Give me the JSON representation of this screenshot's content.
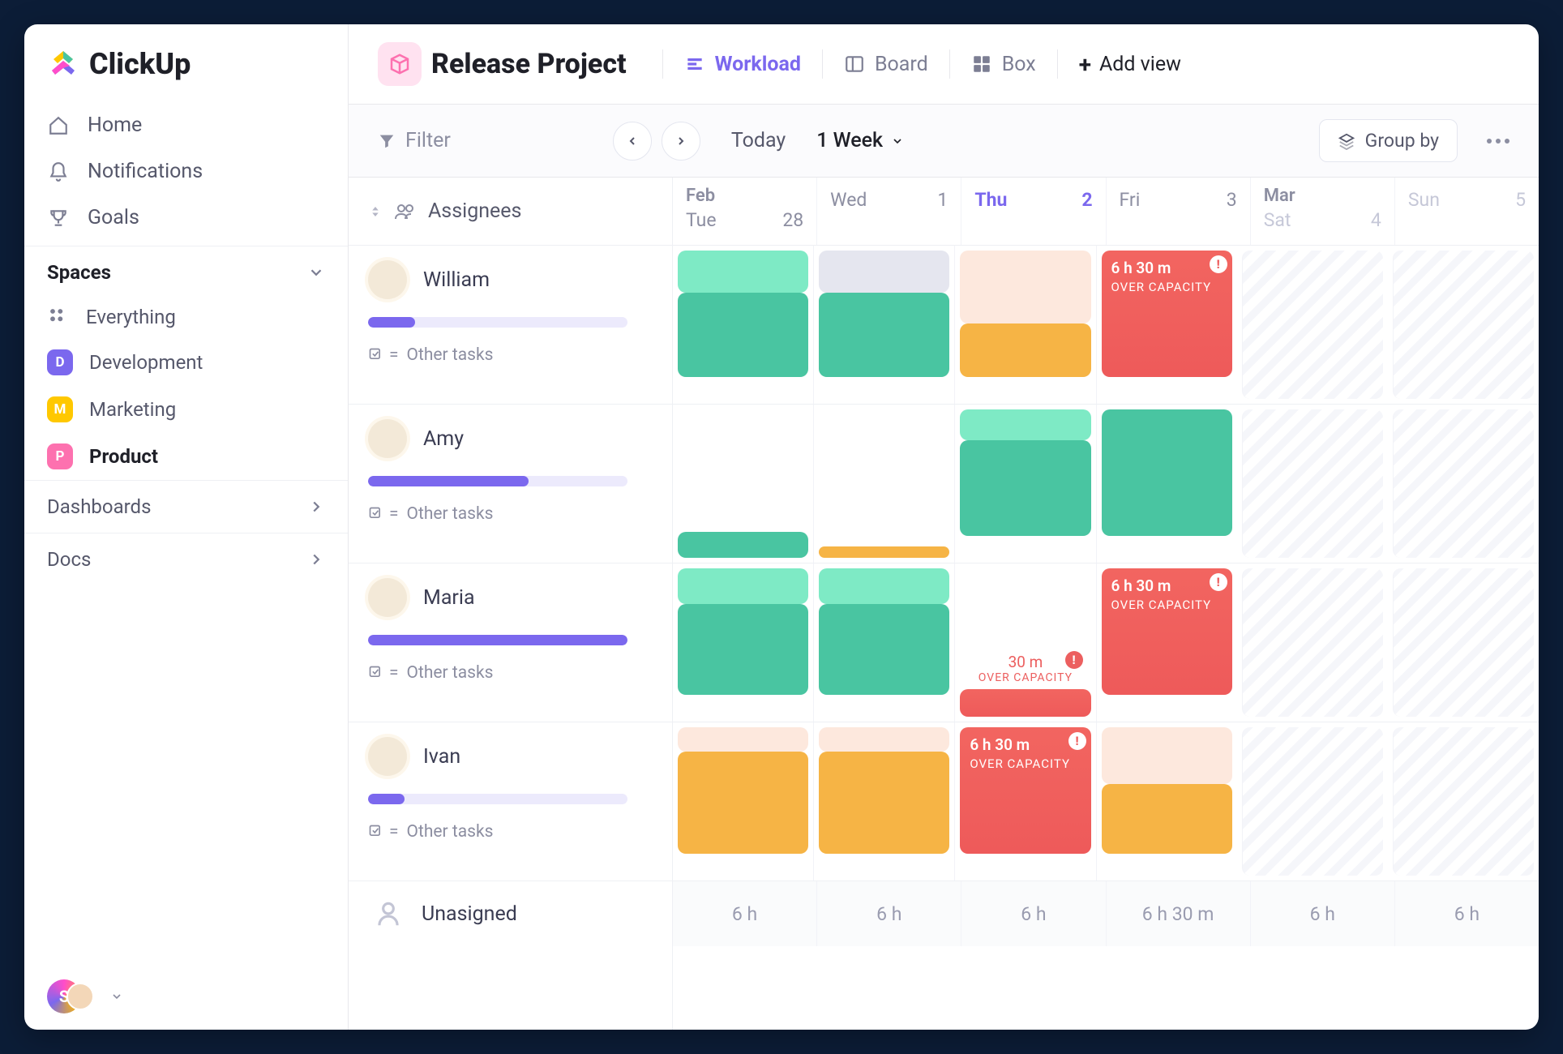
{
  "brand": "ClickUp",
  "nav": {
    "home": "Home",
    "notifications": "Notifications",
    "goals": "Goals"
  },
  "spaces": {
    "header": "Spaces",
    "everything": "Everything",
    "items": [
      {
        "letter": "D",
        "label": "Development"
      },
      {
        "letter": "M",
        "label": "Marketing"
      },
      {
        "letter": "P",
        "label": "Product"
      }
    ],
    "dashboards": "Dashboards",
    "docs": "Docs"
  },
  "header": {
    "project": "Release Project",
    "views": {
      "workload": "Workload",
      "board": "Board",
      "box": "Box",
      "add": "Add view"
    }
  },
  "toolbar": {
    "filter": "Filter",
    "today": "Today",
    "range": "1 Week",
    "groupby": "Group by"
  },
  "gridHeader": {
    "assignees": "Assignees",
    "days": [
      {
        "month": "Feb",
        "name": "Tue",
        "num": "28"
      },
      {
        "month": "",
        "name": "Wed",
        "num": "1"
      },
      {
        "month": "",
        "name": "Thu",
        "num": "2",
        "today": true
      },
      {
        "month": "",
        "name": "Fri",
        "num": "3"
      },
      {
        "month": "Mar",
        "name": "Sat",
        "num": "4",
        "weekend": true
      },
      {
        "month": "",
        "name": "Sun",
        "num": "5",
        "weekend": true
      }
    ]
  },
  "assignees": [
    {
      "name": "William",
      "barPct": 18,
      "other": "Other tasks"
    },
    {
      "name": "Amy",
      "barPct": 62,
      "other": "Other tasks"
    },
    {
      "name": "Maria",
      "barPct": 100,
      "other": "Other tasks"
    },
    {
      "name": "Ivan",
      "barPct": 14,
      "other": "Other tasks"
    }
  ],
  "unassigned": "Unasigned",
  "over": {
    "time": "6 h 30 m",
    "label": "OVER CAPACITY",
    "shortTime": "30 m"
  },
  "footer": [
    "6 h",
    "6 h",
    "6 h",
    "6 h 30 m",
    "6 h",
    "6 h"
  ]
}
